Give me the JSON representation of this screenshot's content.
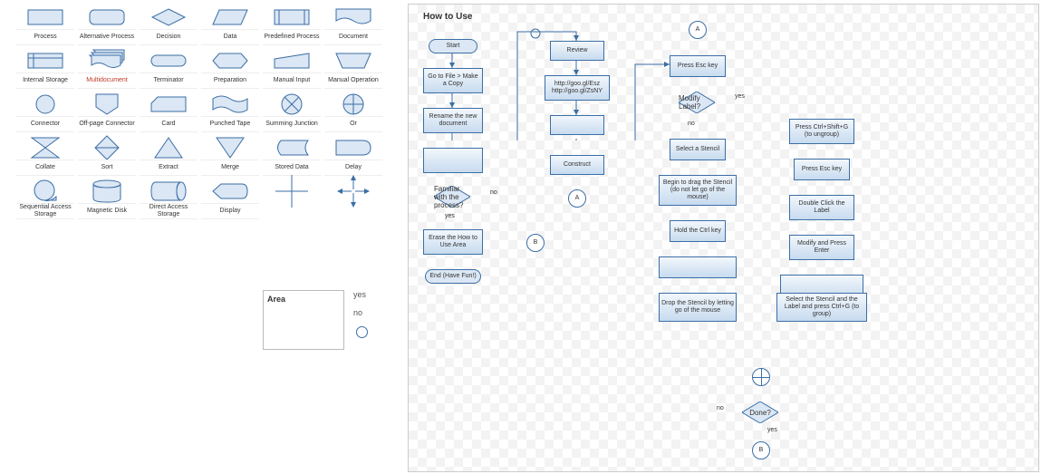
{
  "palette": {
    "rows": [
      [
        "Process",
        "Alternative Process",
        "Decision",
        "Data",
        "Predefined Process",
        "Document"
      ],
      [
        "Internal Storage",
        "Multidocument",
        "Terminator",
        "Preparation",
        "Manual Input",
        "Manual Operation"
      ],
      [
        "Connector",
        "Off-page Connector",
        "Card",
        "Punched Tape",
        "Summing Junction",
        "Or"
      ],
      [
        "Collate",
        "Sort",
        "Extract",
        "Merge",
        "Stored Data",
        "Delay"
      ],
      [
        "Sequential Access Storage",
        "Magnetic Disk",
        "Direct Access Storage",
        "Display",
        "",
        ""
      ]
    ],
    "red_label": "Multidocument",
    "area": "Area",
    "yes": "yes",
    "no": "no"
  },
  "flow": {
    "title": "How to Use",
    "col1": {
      "start": "Start",
      "copy": "Go to File > Make a Copy",
      "rename": "Rename the new document",
      "familiar": "Familiar with the process?",
      "erase": "Erase the How to Use Area",
      "end": "End (Have Fun!)"
    },
    "col2": {
      "review": "Review",
      "links": "http://goo.gl/Esz\nhttp://goo.gl/ZsNY",
      "construct": "Construct",
      "A": "A"
    },
    "col3": {
      "A": "A",
      "press_esc": "Press Esc key",
      "modify_label": "Modify Label?",
      "select": "Select a Stencil",
      "begin_drag": "Begin to drag the Stencil (do not let go of the mouse)",
      "hold_ctrl": "Hold the Ctrl key",
      "drop": "Drop the Stencil by letting go of the mouse",
      "done": "Done?",
      "B": "B"
    },
    "col4": {
      "ctrl_shift_g": "Press Ctrl+Shift+G (to ungroup)",
      "press_esc2": "Press Esc key",
      "dbl_click": "Double Click the Label",
      "modify_enter": "Modify and Press Enter",
      "group": "Select the Stencil and the Label and press Ctrl+G (to group)"
    },
    "labels": {
      "yes": "yes",
      "no": "no"
    }
  }
}
